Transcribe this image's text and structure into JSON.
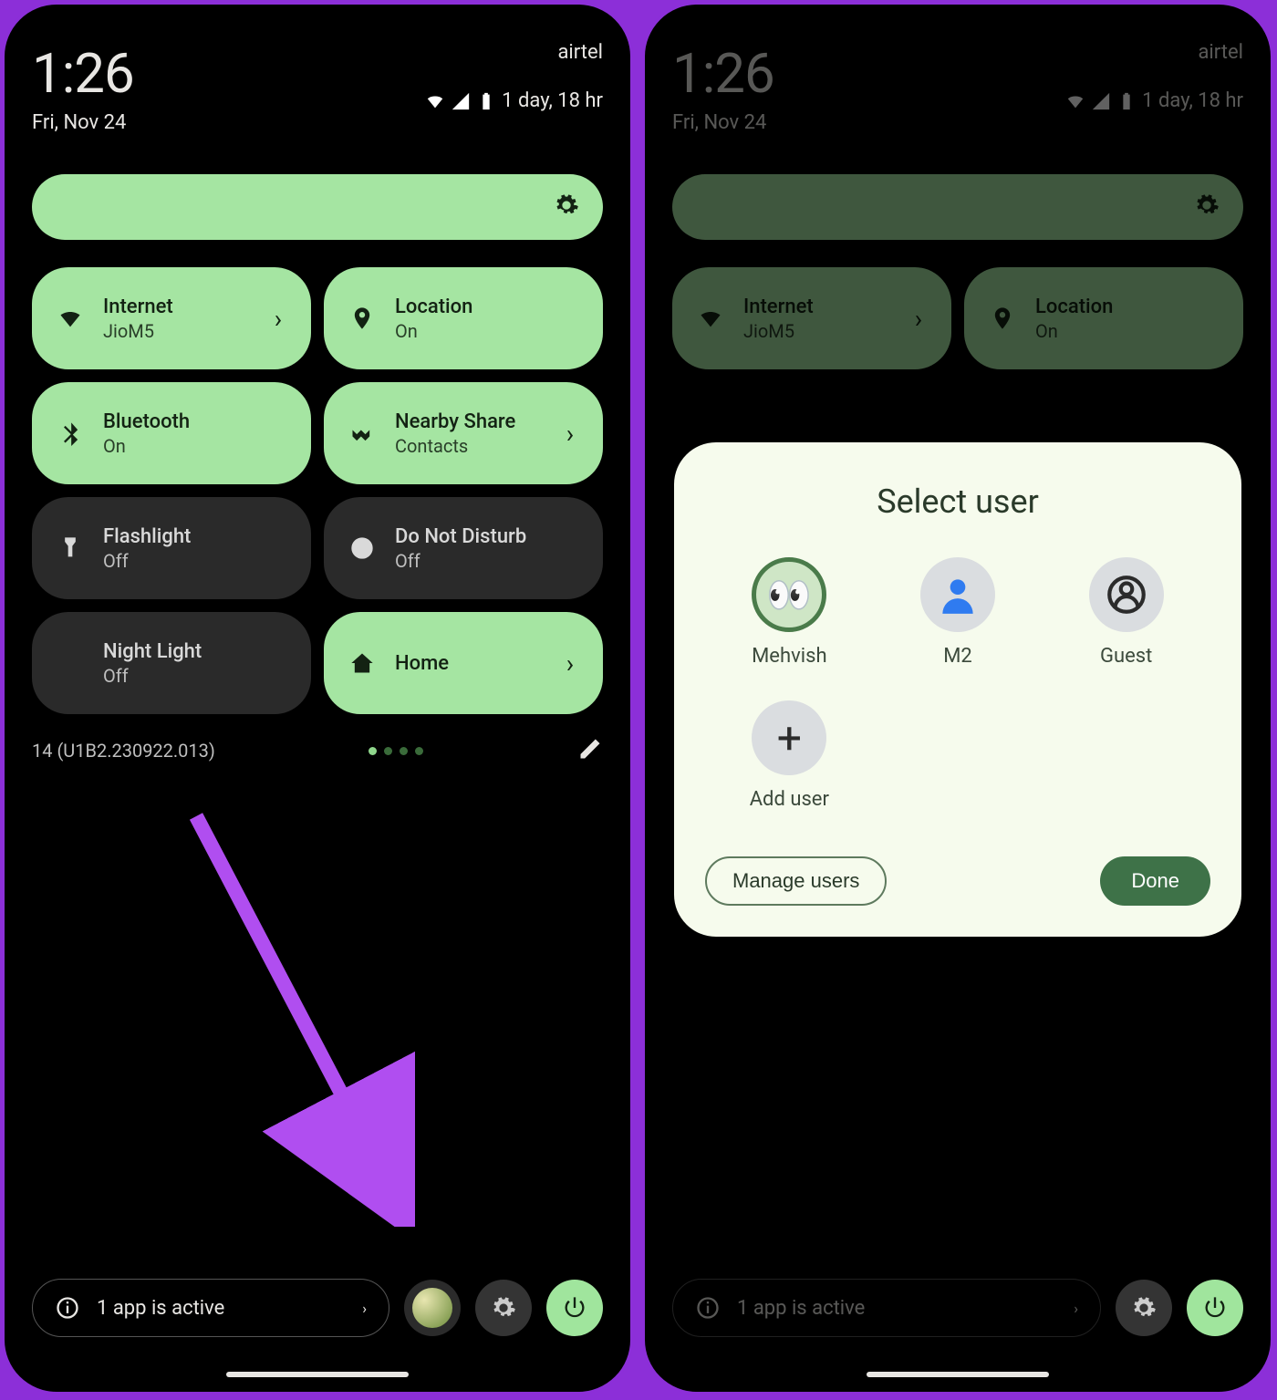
{
  "status": {
    "time": "1:26",
    "date": "Fri, Nov 24",
    "carrier": "airtel",
    "battery_text": "1 day, 18 hr"
  },
  "tiles": {
    "internet": {
      "title": "Internet",
      "sub": "JioM5"
    },
    "location": {
      "title": "Location",
      "sub": "On"
    },
    "bluetooth": {
      "title": "Bluetooth",
      "sub": "On"
    },
    "nearby": {
      "title": "Nearby Share",
      "sub": "Contacts"
    },
    "flashlight": {
      "title": "Flashlight",
      "sub": "Off"
    },
    "dnd": {
      "title": "Do Not Disturb",
      "sub": "Off"
    },
    "nightlight": {
      "title": "Night Light",
      "sub": "Off"
    },
    "home": {
      "title": "Home",
      "sub": ""
    }
  },
  "build": "14 (U1B2.230922.013)",
  "active_apps": "1 app is active",
  "modal": {
    "title": "Select user",
    "users": [
      "Mehvish",
      "M2",
      "Guest",
      "Add user"
    ],
    "manage": "Manage users",
    "done": "Done"
  }
}
